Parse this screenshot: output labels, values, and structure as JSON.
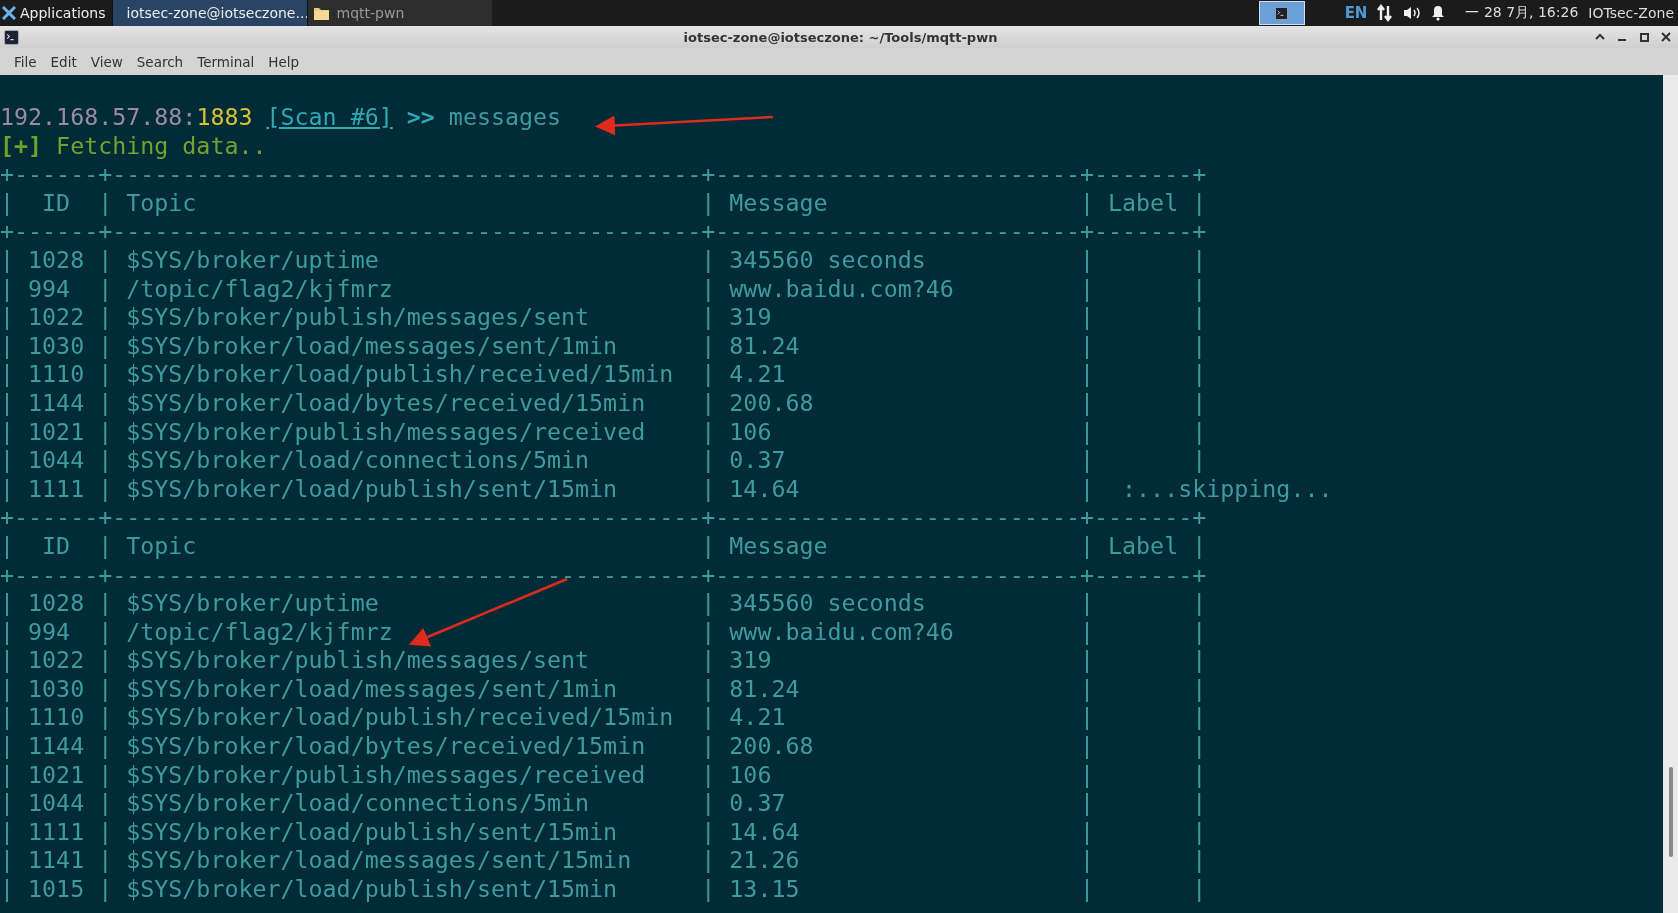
{
  "panel": {
    "menu_label": "Applications",
    "tasks": [
      {
        "label": "iotsec-zone@iotseczone...",
        "kind": "terminal",
        "selected": true
      },
      {
        "label": "mqtt-pwn",
        "kind": "folder",
        "selected": false
      }
    ],
    "language": "EN",
    "clock": "一 28 7月, 16:26",
    "user": "IOTsec-Zone"
  },
  "window": {
    "title": "iotsec-zone@iotseczone: ~/Tools/mqtt-pwn"
  },
  "menu": [
    "File",
    "Edit",
    "View",
    "Search",
    "Terminal",
    "Help"
  ],
  "terminal": {
    "lines": [
      {
        "kind": "prompt",
        "segments": [
          {
            "kind": "host",
            "text": "192.168.57.88:"
          },
          {
            "kind": "port",
            "text": "1883"
          },
          {
            "kind": "scan",
            "text": " [Scan #6]"
          },
          {
            "kind": "arrow",
            "text": " >>"
          },
          {
            "kind": "command",
            "text": " messages"
          }
        ]
      },
      {
        "kind": "info",
        "segments": [
          {
            "kind": "marker",
            "text": "[+]"
          },
          {
            "kind": "text",
            "text": " Fetching data.."
          }
        ]
      },
      {
        "kind": "table",
        "text": "+------+------------------------------------------+--------------------------+-------+"
      },
      {
        "kind": "table",
        "text": "|  ID  | Topic                                    | Message                  | Label |"
      },
      {
        "kind": "table",
        "text": "+------+------------------------------------------+--------------------------+-------+"
      },
      {
        "kind": "table",
        "text": "| 1028 | $SYS/broker/uptime                       | 345560 seconds           |       |"
      },
      {
        "kind": "table",
        "text": "| 994  | /topic/flag2/kjfmrz                      | www.baidu.com?46         |       |"
      },
      {
        "kind": "table",
        "text": "| 1022 | $SYS/broker/publish/messages/sent        | 319                      |       |"
      },
      {
        "kind": "table",
        "text": "| 1030 | $SYS/broker/load/messages/sent/1min      | 81.24                    |       |"
      },
      {
        "kind": "table",
        "text": "| 1110 | $SYS/broker/load/publish/received/15min  | 4.21                     |       |"
      },
      {
        "kind": "table",
        "text": "| 1144 | $SYS/broker/load/bytes/received/15min    | 200.68                   |       |"
      },
      {
        "kind": "table",
        "text": "| 1021 | $SYS/broker/publish/messages/received    | 106                      |       |"
      },
      {
        "kind": "table",
        "text": "| 1044 | $SYS/broker/load/connections/5min        | 0.37                     |       |"
      },
      {
        "kind": "table",
        "text": "| 1111 | $SYS/broker/load/publish/sent/15min      | 14.64                    |  :...skipping..."
      },
      {
        "kind": "table",
        "text": "+------+------------------------------------------+--------------------------+-------+"
      },
      {
        "kind": "table",
        "text": "|  ID  | Topic                                    | Message                  | Label |"
      },
      {
        "kind": "table",
        "text": "+------+------------------------------------------+--------------------------+-------+"
      },
      {
        "kind": "table",
        "text": "| 1028 | $SYS/broker/uptime                       | 345560 seconds           |       |"
      },
      {
        "kind": "table",
        "text": "| 994  | /topic/flag2/kjfmrz                      | www.baidu.com?46         |       |"
      },
      {
        "kind": "table",
        "text": "| 1022 | $SYS/broker/publish/messages/sent        | 319                      |       |"
      },
      {
        "kind": "table",
        "text": "| 1030 | $SYS/broker/load/messages/sent/1min      | 81.24                    |       |"
      },
      {
        "kind": "table",
        "text": "| 1110 | $SYS/broker/load/publish/received/15min  | 4.21                     |       |"
      },
      {
        "kind": "table",
        "text": "| 1144 | $SYS/broker/load/bytes/received/15min    | 200.68                   |       |"
      },
      {
        "kind": "table",
        "text": "| 1021 | $SYS/broker/publish/messages/received    | 106                      |       |"
      },
      {
        "kind": "table",
        "text": "| 1044 | $SYS/broker/load/connections/5min        | 0.37                     |       |"
      },
      {
        "kind": "table",
        "text": "| 1111 | $SYS/broker/load/publish/sent/15min      | 14.64                    |       |"
      },
      {
        "kind": "table",
        "text": "| 1141 | $SYS/broker/load/messages/sent/15min     | 21.26                    |       |"
      },
      {
        "kind": "table",
        "text": "| 1015 | $SYS/broker/load/publish/sent/15min      | 13.15                    |       |"
      }
    ]
  }
}
